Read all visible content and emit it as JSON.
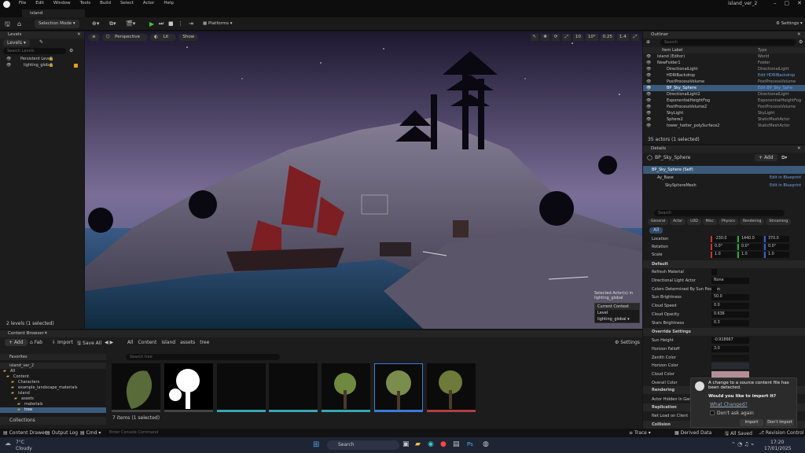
{
  "menu": [
    "File",
    "Edit",
    "Window",
    "Tools",
    "Build",
    "Select",
    "Actor",
    "Help"
  ],
  "project_title": "island_ver_2",
  "tab_label": "island",
  "toolbar": {
    "mode": "Selection Mode",
    "platforms": "Platforms",
    "settings": "Settings"
  },
  "levels_panel": {
    "title": "Levels",
    "dropdown": "Levels",
    "search_placeholder": "Search Levels",
    "rows": [
      "Persistent Level",
      "lighting_global"
    ],
    "footer": "2 levels (1 selected)"
  },
  "viewport": {
    "perspective": "Perspective",
    "lit": "Lit",
    "show": "Show",
    "right_tools": [
      "10",
      "10°",
      "0.25",
      "1.4"
    ],
    "selected_actor": "Selected Actor(s) in",
    "selected_level": "lighting_global",
    "current_context": "Current Context",
    "level_label": "Level",
    "level_value": "lighting_global"
  },
  "outliner": {
    "title": "Outliner",
    "search_placeholder": "Search",
    "col_label": "Item Label",
    "col_type": "Type",
    "rows": [
      {
        "label": "island (Editor)",
        "type": "World"
      },
      {
        "label": "NewFolder1",
        "type": "Folder"
      },
      {
        "label": "DirectionalLight",
        "type": "DirectionalLight"
      },
      {
        "label": "HDRIBackdrop",
        "type": "Edit HDRIBackdrop"
      },
      {
        "label": "PostProcessVolume",
        "type": "PostProcessVolume"
      },
      {
        "label": "BP_Sky_Sphere",
        "type": "Edit BP_Sky_Sphe"
      },
      {
        "label": "DirectionalLight2",
        "type": "DirectionalLight"
      },
      {
        "label": "ExponentialHeightFog",
        "type": "ExponentialHeightFog"
      },
      {
        "label": "PostProcessVolume2",
        "type": "PostProcessVolume"
      },
      {
        "label": "SkyLight",
        "type": "SkyLight"
      },
      {
        "label": "Sphere2",
        "type": "StaticMeshActor"
      },
      {
        "label": "tower_hatter_polySurface2",
        "type": "StaticMeshActor"
      }
    ],
    "footer": "35 actors (1 selected)"
  },
  "details": {
    "title": "Details",
    "object": "BP_Sky_Sphere",
    "add": "Add",
    "self": "BP_Sky_Sphere (Self)",
    "component1": "Ay_Base",
    "component2": "SkySphereMesh",
    "edit_bp": "Edit in Blueprint",
    "search_placeholder": "Search",
    "tabs": [
      "General",
      "Actor",
      "LOD",
      "Misc",
      "Physics",
      "Rendering",
      "Streaming"
    ],
    "all": "All",
    "transform": [
      {
        "label": "Location",
        "x": "-230.0",
        "y": "1440.0",
        "z": "370.0"
      },
      {
        "label": "Rotation",
        "x": "0.0°",
        "y": "0.0°",
        "z": "0.0°"
      },
      {
        "label": "Scale",
        "x": "1.0",
        "y": "1.0",
        "z": "1.0"
      }
    ],
    "default_header": "Default",
    "props": [
      {
        "label": "Refresh Material",
        "value": ""
      },
      {
        "label": "Directional Light Actor",
        "value": "None"
      },
      {
        "label": "Colors Determined By Sun Position",
        "value": ""
      },
      {
        "label": "Sun Brightness",
        "value": "50.0"
      },
      {
        "label": "Cloud Speed",
        "value": "0.0"
      },
      {
        "label": "Cloud Opacity",
        "value": "0.636"
      },
      {
        "label": "Stars Brightness",
        "value": "0.3"
      }
    ],
    "override_header": "Override Settings",
    "override_props": [
      {
        "label": "Sun Height",
        "value": "-0.918667"
      },
      {
        "label": "Horizon Falloff",
        "value": "3.0"
      },
      {
        "label": "Zenith Color",
        "value": ""
      },
      {
        "label": "Horizon Color",
        "value": ""
      },
      {
        "label": "Cloud Color",
        "value": ""
      },
      {
        "label": "Overall Color",
        "value": ""
      }
    ],
    "rendering_header": "Rendering",
    "rendering_prop": "Actor Hidden In Game",
    "replication_header": "Replication",
    "replication_prop": "Net Load on Client",
    "collision_header": "Collision"
  },
  "content_browser": {
    "title": "Content Browser",
    "add": "Add",
    "fab": "Fab",
    "import": "Import",
    "save_all": "Save All",
    "path": [
      "All",
      "Content",
      "island",
      "assets",
      "tree"
    ],
    "settings": "Settings",
    "search_placeholder": "Search tree",
    "favorites": "Favorites",
    "project": "island_ver_2",
    "tree": [
      "All",
      "Content",
      "Characters",
      "example_landscape_materials",
      "island",
      "assets",
      "materials",
      "tree"
    ],
    "footer": "7 items (1 selected)",
    "collections": "Collections"
  },
  "notification": {
    "title": "A change to a source content file has been detected.",
    "question": "Would you like to import it?",
    "link": "What Changed?",
    "checkbox": "Don't ask again",
    "import": "Import",
    "dont_import": "Don't Import"
  },
  "statusbar": {
    "drawer": "Content Drawer",
    "output": "Output Log",
    "cmd": "Cmd",
    "console_placeholder": "Enter Console Command",
    "trace": "Trace",
    "derived": "Derived Data",
    "saved": "All Saved",
    "revision": "Revision Control"
  },
  "taskbar": {
    "temp": "7°C",
    "weather": "Cloudy",
    "search": "Search",
    "time": "17:20",
    "date": "17/01/2025"
  }
}
